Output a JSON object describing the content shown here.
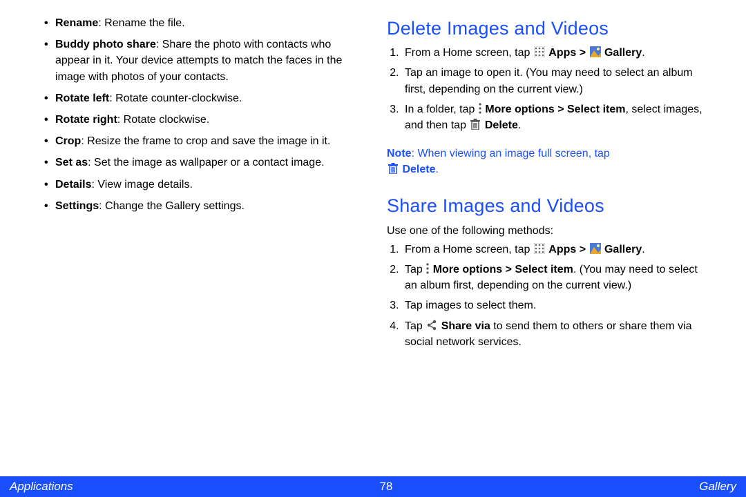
{
  "left": {
    "items": [
      {
        "label": "Rename",
        "desc": ": Rename the file."
      },
      {
        "label": "Buddy photo share",
        "desc": ": Share the photo with contacts who appear in it. Your device attempts to match the faces in the image with photos of your contacts."
      },
      {
        "label": "Rotate left",
        "desc": ": Rotate counter-clockwise."
      },
      {
        "label": "Rotate right",
        "desc": ": Rotate clockwise."
      },
      {
        "label": "Crop",
        "desc": ": Resize the frame to crop and save the image in it."
      },
      {
        "label": "Set as",
        "desc": ": Set the image as wallpaper or a contact image."
      },
      {
        "label": "Details",
        "desc": ": View image details."
      },
      {
        "label": "Settings",
        "desc": ": Change the Gallery settings."
      }
    ]
  },
  "right": {
    "delete_heading": "Delete Images and Videos",
    "share_heading": "Share Images and Videos",
    "txt": {
      "from_home": "From a Home screen, tap ",
      "apps_gt": "Apps > ",
      "gallery": "Gallery",
      "period": ".",
      "step2_delete": "Tap an image to open it. (You may need to select an album first, depending on the current view.)",
      "step3_a": "In a folder, tap ",
      "more_options_select": "More options > Select item",
      "step3_b": ", select images, and then tap ",
      "delete": "Delete",
      "note_label": "Note",
      "note_a": ": When viewing an image full screen, tap ",
      "share_intro": "Use one of the following methods:",
      "tap": "Tap ",
      "step2_share_tail": ". (You may need to select an album first, depending on the current view.)",
      "step3_share": "Tap images to select them.",
      "share_via": "Share via",
      "step4_share_tail": " to send them to others or share them via social network services."
    }
  },
  "footer": {
    "left": "Applications",
    "page": "78",
    "right": "Gallery"
  }
}
